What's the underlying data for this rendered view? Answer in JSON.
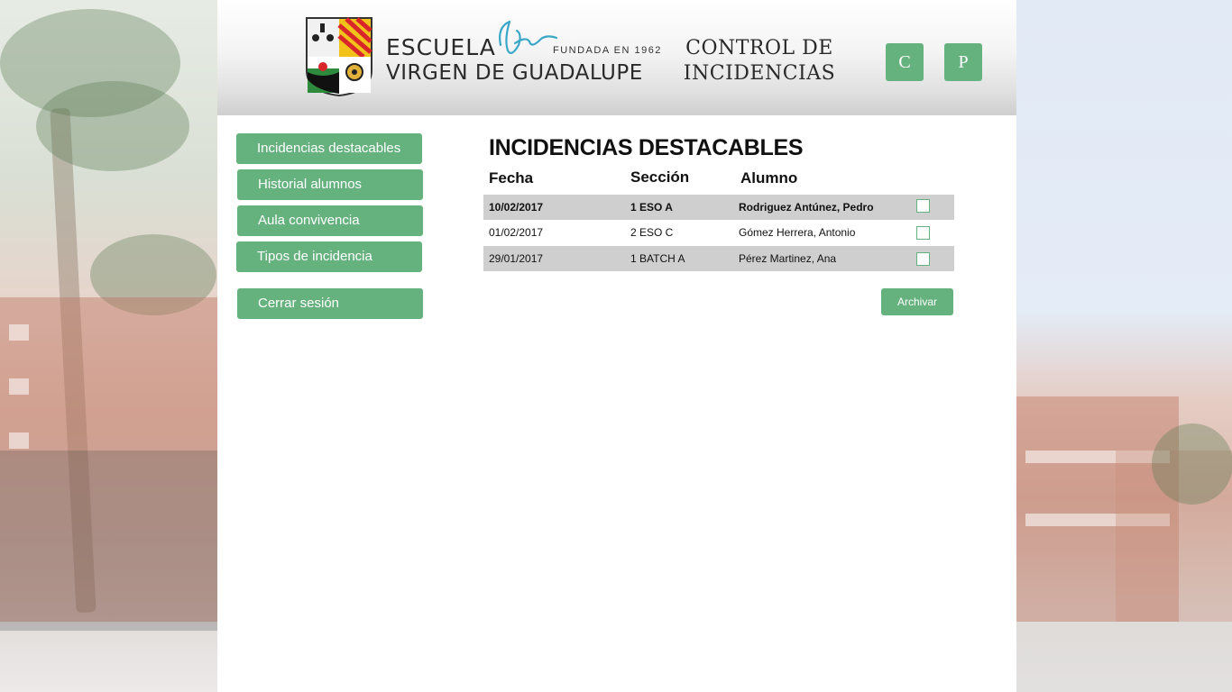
{
  "header": {
    "school_line1": "ESCUELA",
    "school_line2": "VIRGEN DE GUADALUPE",
    "founded": "FUNDADA EN 1962",
    "app_title_line1": "CONTROL DE",
    "app_title_line2": "INCIDENCIAS",
    "buttons": [
      {
        "label": "C"
      },
      {
        "label": "P"
      }
    ]
  },
  "sidebar": {
    "items": [
      {
        "label": "Incidencias destacables"
      },
      {
        "label": "Historial alumnos"
      },
      {
        "label": "Aula convivencia"
      },
      {
        "label": "Tipos de incidencia"
      }
    ],
    "logout_label": "Cerrar sesión"
  },
  "main": {
    "title": "INCIDENCIAS DESTACABLES",
    "columns": [
      "Fecha",
      "Sección",
      "Alumno"
    ],
    "rows": [
      {
        "fecha": "10/02/2017",
        "seccion": "1 ESO A",
        "alumno": "Rodriguez Antúnez, Pedro",
        "checked": false
      },
      {
        "fecha": "01/02/2017",
        "seccion": "2 ESO C",
        "alumno": "Gómez Herrera, Antonio",
        "checked": false
      },
      {
        "fecha": "29/01/2017",
        "seccion": "1 BATCH A",
        "alumno": "Pérez Martinez, Ana",
        "checked": false
      }
    ],
    "archive_label": "Archivar"
  },
  "colors": {
    "accent_green": "#66b27f",
    "row_shade": "#cfcfcf",
    "signature_blue": "#3aa7c9"
  }
}
